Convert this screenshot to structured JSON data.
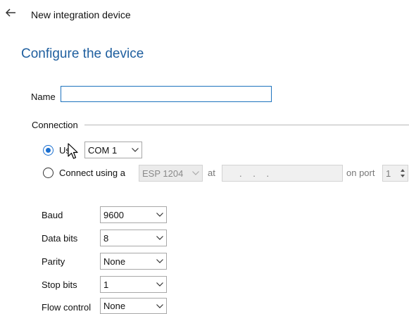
{
  "header": {
    "title": "New integration device",
    "back_icon": "arrow-left-icon"
  },
  "page": {
    "section_title": "Configure the device"
  },
  "name_field": {
    "label": "Name",
    "value": "",
    "placeholder": ""
  },
  "connection": {
    "group_label": "Connection",
    "use_option": {
      "label": "Use",
      "checked": true,
      "port_value": "COM 1"
    },
    "connect_option": {
      "label": "Connect using a",
      "checked": false,
      "device_value": "ESP 1204",
      "at_label": "at",
      "ip_value": ". . .",
      "port_label": "on port",
      "port_value": "1"
    }
  },
  "serial": {
    "baud": {
      "label": "Baud",
      "value": "9600"
    },
    "data_bits": {
      "label": "Data bits",
      "value": "8"
    },
    "parity": {
      "label": "Parity",
      "value": "None"
    },
    "stop_bits": {
      "label": "Stop bits",
      "value": "1"
    },
    "flow_control": {
      "label": "Flow control",
      "value": "None"
    }
  },
  "colors": {
    "accent": "#1a6fd0",
    "title": "#1f5f9f",
    "input_focus_border": "#1e73be"
  }
}
